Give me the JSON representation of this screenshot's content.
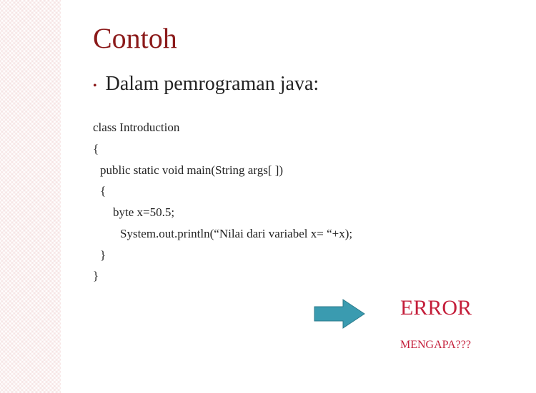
{
  "slide": {
    "title": "Contoh",
    "bullet_text": "Dalam pemrograman java:",
    "code": {
      "line1": "class Introduction",
      "line2": "{",
      "line3": "public static void main(String args[ ])",
      "line4": "{",
      "line5": "byte x=50.5;",
      "line6": "System.out.println(“Nilai dari variabel x= “+x);",
      "line7": "}",
      "line8": "}"
    },
    "error_label": "ERROR",
    "question_label": "MENGAPA???",
    "arrow_color": "#2e8fa3"
  }
}
